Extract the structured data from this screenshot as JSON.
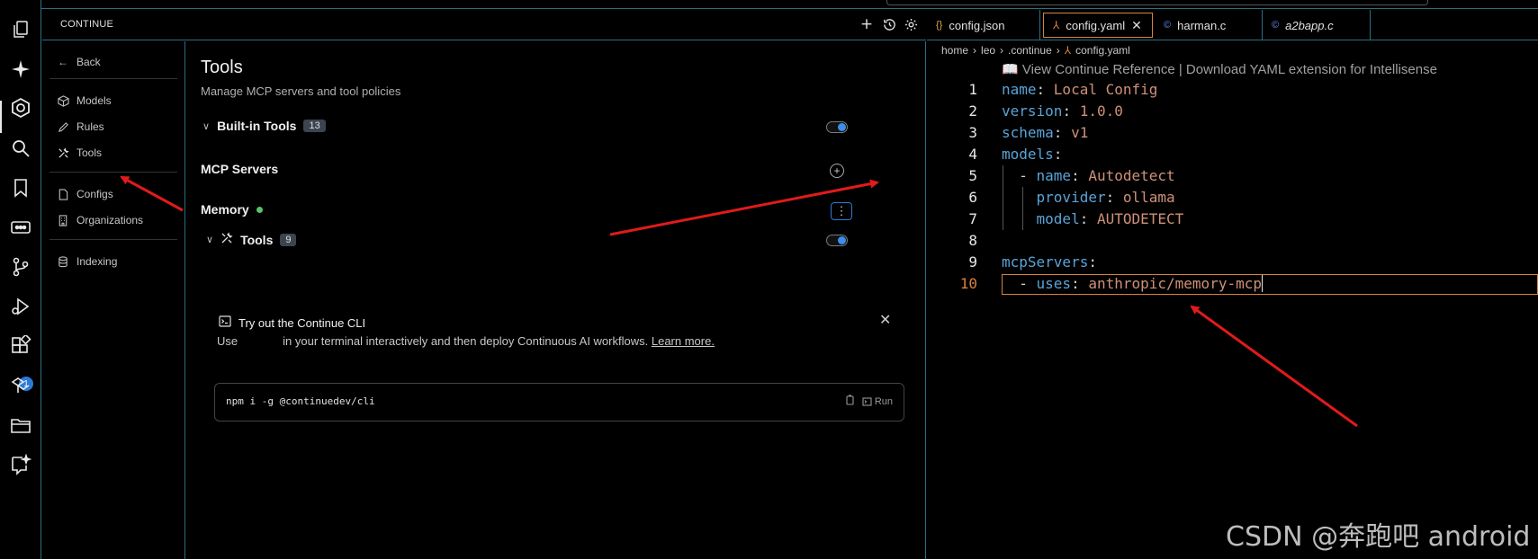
{
  "continue_panel": {
    "title": "CONTINUE",
    "nav": {
      "back": "Back",
      "models": "Models",
      "rules": "Rules",
      "tools": "Tools",
      "configs": "Configs",
      "organizations": "Organizations",
      "indexing": "Indexing"
    },
    "tools_page": {
      "title": "Tools",
      "subtitle": "Manage MCP servers and tool policies",
      "builtin_label": "Built-in Tools",
      "builtin_count": "13",
      "mcp_label": "MCP Servers",
      "memory_label": "Memory",
      "memory_tools_label": "Tools",
      "memory_tools_count": "9"
    },
    "cli_card": {
      "title": "Try out the Continue CLI",
      "desc_before": "Use",
      "desc_after": "in your terminal interactively and then deploy Continuous AI workflows.",
      "learn_more": "Learn more.",
      "command": "npm i -g @continuedev/cli",
      "run_label": "Run"
    }
  },
  "activity_bar": {
    "extensions_badge": "1",
    "icons": [
      "explorer-icon",
      "sparkle-icon",
      "continue-icon",
      "search-icon",
      "bookmark-icon",
      "remote-icon",
      "source-control-icon",
      "run-debug-icon",
      "extensions-icon",
      "deploy-icon",
      "folder-icon",
      "ai-chat-icon"
    ]
  },
  "editor": {
    "tabs": [
      {
        "label": "config.json",
        "icon": "{}"
      },
      {
        "label": "config.yaml",
        "icon": "yaml"
      },
      {
        "label": "harman.c",
        "icon": "C"
      },
      {
        "label": "a2bapp.c",
        "icon": "C"
      }
    ],
    "breadcrumb": [
      "home",
      "leo",
      ".continue",
      "config.yaml"
    ],
    "codelens": "📖 View Continue Reference | Download YAML extension for Intellisense",
    "lines": [
      {
        "n": "1",
        "key": "name",
        "val": "Local Config"
      },
      {
        "n": "2",
        "key": "version",
        "val": "1.0.0"
      },
      {
        "n": "3",
        "key": "schema",
        "val": "v1"
      },
      {
        "n": "4",
        "key": "models",
        "val": ""
      },
      {
        "n": "5",
        "key": "name",
        "val": "Autodetect"
      },
      {
        "n": "6",
        "key": "provider",
        "val": "ollama"
      },
      {
        "n": "7",
        "key": "model",
        "val": "AUTODETECT"
      },
      {
        "n": "8",
        "key": "",
        "val": ""
      },
      {
        "n": "9",
        "key": "mcpServers",
        "val": ""
      },
      {
        "n": "10",
        "key": "uses",
        "val": "anthropic/memory-mcp"
      }
    ]
  },
  "watermark": "CSDN @奔跑吧 android",
  "colors": {
    "accent_border": "#2c6f86",
    "active_tab": "#d8823c",
    "yaml_key": "#5aa3d8",
    "yaml_value": "#ce9178",
    "arrow": "#e01b1b"
  }
}
